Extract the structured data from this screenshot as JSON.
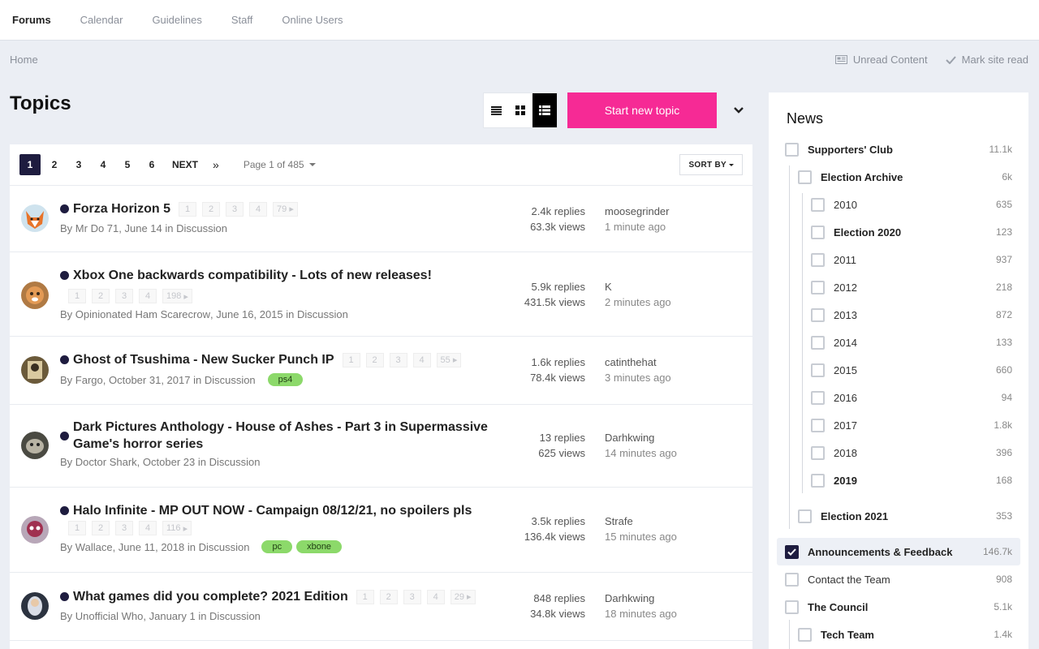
{
  "nav": {
    "items": [
      {
        "label": "Forums",
        "active": true
      },
      {
        "label": "Calendar",
        "active": false
      },
      {
        "label": "Guidelines",
        "active": false
      },
      {
        "label": "Staff",
        "active": false
      },
      {
        "label": "Online Users",
        "active": false
      }
    ]
  },
  "breadcrumb": {
    "home": "Home"
  },
  "site_actions": {
    "unread": "Unread Content",
    "mark_read": "Mark site read"
  },
  "header": {
    "title": "Topics",
    "start_button": "Start new topic"
  },
  "pagination": {
    "pages": [
      "1",
      "2",
      "3",
      "4",
      "5",
      "6"
    ],
    "current": "1",
    "next": "NEXT",
    "last": "»",
    "page_of": "Page 1 of 485",
    "sort_by": "SORT BY"
  },
  "topics": [
    {
      "title": "Forza Horizon 5",
      "pages": [
        "1",
        "2",
        "3",
        "4",
        "79"
      ],
      "author": "Mr Do 71",
      "date": "June 14",
      "forum": "Discussion",
      "tags": [],
      "replies": "2.4k replies",
      "views": "63.3k views",
      "last_user": "moosegrinder",
      "last_time": "1 minute ago"
    },
    {
      "title": "Xbox One backwards compatibility - Lots of new releases!",
      "pages": [
        "1",
        "2",
        "3",
        "4",
        "198"
      ],
      "author": "Opinionated Ham Scarecrow",
      "date": "June 16, 2015",
      "forum": "Discussion",
      "tags": [],
      "replies": "5.9k replies",
      "views": "431.5k views",
      "last_user": "K",
      "last_time": "2 minutes ago"
    },
    {
      "title": "Ghost of Tsushima - New Sucker Punch IP",
      "pages": [
        "1",
        "2",
        "3",
        "4",
        "55"
      ],
      "author": "Fargo",
      "date": "October 31, 2017",
      "forum": "Discussion",
      "tags": [
        "ps4"
      ],
      "replies": "1.6k replies",
      "views": "78.4k views",
      "last_user": "catinthehat",
      "last_time": "3 minutes ago"
    },
    {
      "title": "Dark Pictures Anthology - House of Ashes - Part 3 in Supermassive Game's horror series",
      "pages": [],
      "author": "Doctor Shark",
      "date": "October 23",
      "forum": "Discussion",
      "tags": [],
      "replies": "13 replies",
      "views": "625 views",
      "last_user": "Darhkwing",
      "last_time": "14 minutes ago"
    },
    {
      "title": "Halo Infinite - MP OUT NOW - Campaign 08/12/21, no spoilers pls",
      "pages": [
        "1",
        "2",
        "3",
        "4",
        "116"
      ],
      "author": "Wallace",
      "date": "June 11, 2018",
      "forum": "Discussion",
      "tags": [
        "pc",
        "xbone"
      ],
      "replies": "3.5k replies",
      "views": "136.4k views",
      "last_user": "Strafe",
      "last_time": "15 minutes ago"
    },
    {
      "title": "What games did you complete? 2021 Edition",
      "pages": [
        "1",
        "2",
        "3",
        "4",
        "29"
      ],
      "author": "Unofficial Who",
      "date": "January 1",
      "forum": "Discussion",
      "tags": [],
      "replies": "848 replies",
      "views": "34.8k views",
      "last_user": "Darhkwing",
      "last_time": "18 minutes ago"
    }
  ],
  "sidebar": {
    "title": "News",
    "items": [
      {
        "label": "Supporters' Club",
        "count": "11.1k",
        "bold": true,
        "checked": false
      },
      {
        "label": "Election Archive",
        "count": "6k",
        "bold": true,
        "checked": false
      },
      {
        "label": "2010",
        "count": "635",
        "bold": false,
        "checked": false
      },
      {
        "label": "Election 2020",
        "count": "123",
        "bold": true,
        "checked": false
      },
      {
        "label": "2011",
        "count": "937",
        "bold": false,
        "checked": false
      },
      {
        "label": "2012",
        "count": "218",
        "bold": false,
        "checked": false
      },
      {
        "label": "2013",
        "count": "872",
        "bold": false,
        "checked": false
      },
      {
        "label": "2014",
        "count": "133",
        "bold": false,
        "checked": false
      },
      {
        "label": "2015",
        "count": "660",
        "bold": false,
        "checked": false
      },
      {
        "label": "2016",
        "count": "94",
        "bold": false,
        "checked": false
      },
      {
        "label": "2017",
        "count": "1.8k",
        "bold": false,
        "checked": false
      },
      {
        "label": "2018",
        "count": "396",
        "bold": false,
        "checked": false
      },
      {
        "label": "2019",
        "count": "168",
        "bold": true,
        "checked": false
      },
      {
        "label": "Election 2021",
        "count": "353",
        "bold": true,
        "checked": false
      },
      {
        "label": "Announcements & Feedback",
        "count": "146.7k",
        "bold": true,
        "checked": true
      },
      {
        "label": "Contact the Team",
        "count": "908",
        "bold": false,
        "checked": false
      },
      {
        "label": "The Council",
        "count": "5.1k",
        "bold": true,
        "checked": false
      },
      {
        "label": "Tech Team",
        "count": "1.4k",
        "bold": true,
        "checked": false
      }
    ]
  },
  "colors": {
    "accent": "#f62a95",
    "dark": "#1e1c3f",
    "tag": "#8cd96a"
  }
}
